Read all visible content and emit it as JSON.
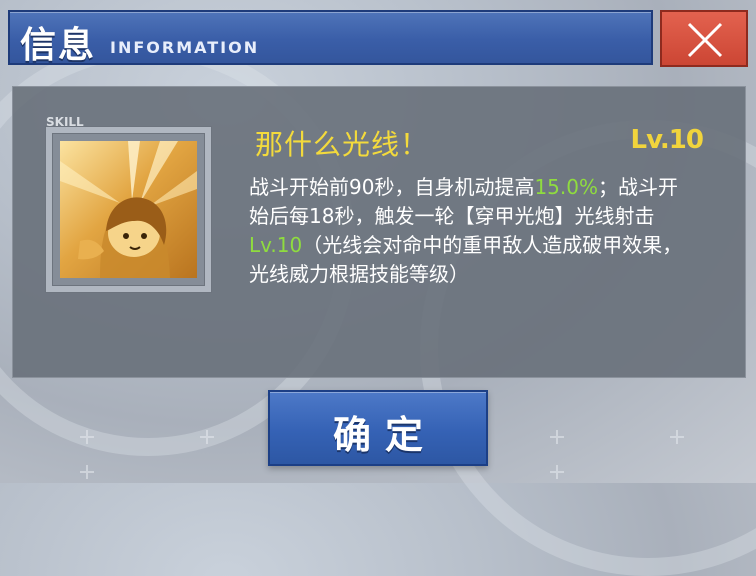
{
  "header": {
    "title_zh": "信息",
    "title_en": "INFORMATION"
  },
  "close_button": {
    "icon": "close-icon"
  },
  "skill": {
    "tag": "SKILL",
    "icon": "skill-portrait-icon",
    "name": "那什么光线！",
    "level": "Lv.10",
    "description": {
      "p1": "战斗开始前90秒，自身机动提高",
      "v1": "15.0%",
      "p2": "；战斗开始后每18秒，触发一轮【穿甲光炮】光线射击",
      "v2": "Lv.10",
      "p3": "（光线会对命中的重甲敌人造成破甲效果，光线威力根据技能等级）"
    }
  },
  "confirm_button": {
    "label": "确定"
  },
  "colors": {
    "title_bar": "#3a5ea8",
    "close_button": "#d44f3d",
    "skill_name": "#f3da3c",
    "highlight": "#8fdc3f",
    "panel": "#68707a"
  }
}
